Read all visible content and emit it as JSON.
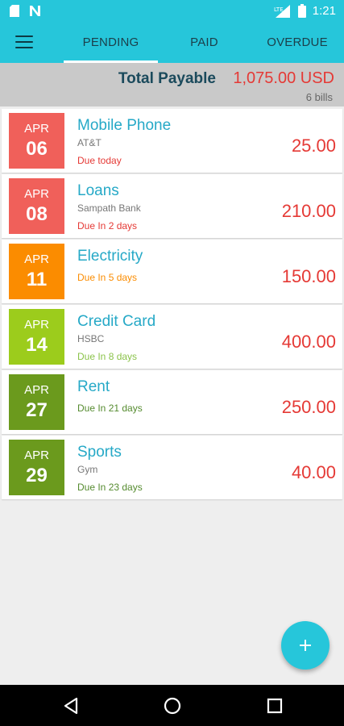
{
  "status": {
    "time": "1:21",
    "network": "LTE"
  },
  "tabs": [
    {
      "label": "PENDING"
    },
    {
      "label": "PAID"
    },
    {
      "label": "OVERDUE"
    }
  ],
  "summary": {
    "label": "Total Payable",
    "amount": "1,075.00 USD",
    "count": "6 bills"
  },
  "bills": [
    {
      "month": "APR",
      "day": "06",
      "name": "Mobile Phone",
      "sub": "AT&T",
      "due": "Due today",
      "amount": "25.00",
      "box_color": "#f0605a",
      "due_color": "#e53935"
    },
    {
      "month": "APR",
      "day": "08",
      "name": "Loans",
      "sub": "Sampath Bank",
      "due": "Due In 2 days",
      "amount": "210.00",
      "box_color": "#f0605a",
      "due_color": "#e53935"
    },
    {
      "month": "APR",
      "day": "11",
      "name": "Electricity",
      "sub": "",
      "due": "Due In 5 days",
      "amount": "150.00",
      "box_color": "#fb8c00",
      "due_color": "#fb8c00"
    },
    {
      "month": "APR",
      "day": "14",
      "name": "Credit Card",
      "sub": "HSBC",
      "due": "Due In 8 days",
      "amount": "400.00",
      "box_color": "#9ccc1c",
      "due_color": "#8bc34a"
    },
    {
      "month": "APR",
      "day": "27",
      "name": "Rent",
      "sub": "",
      "due": "Due In 21 days",
      "amount": "250.00",
      "box_color": "#6b9a1d",
      "due_color": "#558b2f"
    },
    {
      "month": "APR",
      "day": "29",
      "name": "Sports",
      "sub": "Gym",
      "due": "Due In 23 days",
      "amount": "40.00",
      "box_color": "#6b9a1d",
      "due_color": "#558b2f"
    }
  ]
}
